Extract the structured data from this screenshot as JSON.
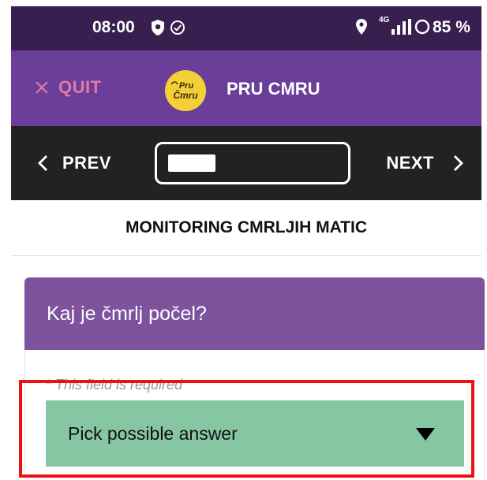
{
  "status_bar": {
    "time": "08:00",
    "network": "4G",
    "battery": "85 %"
  },
  "header": {
    "quit_label": "QUIT",
    "app_title": "PRU CMRU",
    "logo_text": "Pru Cmru"
  },
  "nav": {
    "prev_label": "PREV",
    "next_label": "NEXT",
    "progress": 0.28
  },
  "section": {
    "title": "MONITORING CMRLJIH MATIC"
  },
  "question": {
    "title": "Kaj je čmrlj počel?",
    "required_note": "* This field is required",
    "dropdown_value": "Pick possible answer"
  },
  "colors": {
    "status_bar": "#381f4f",
    "header": "#6a3e99",
    "nav_bar": "#222222",
    "quit": "#e07ba8",
    "logo": "#f4cf35",
    "question_header": "#7d539e",
    "dropdown": "#86c6a3",
    "highlight": "#ee1111"
  }
}
